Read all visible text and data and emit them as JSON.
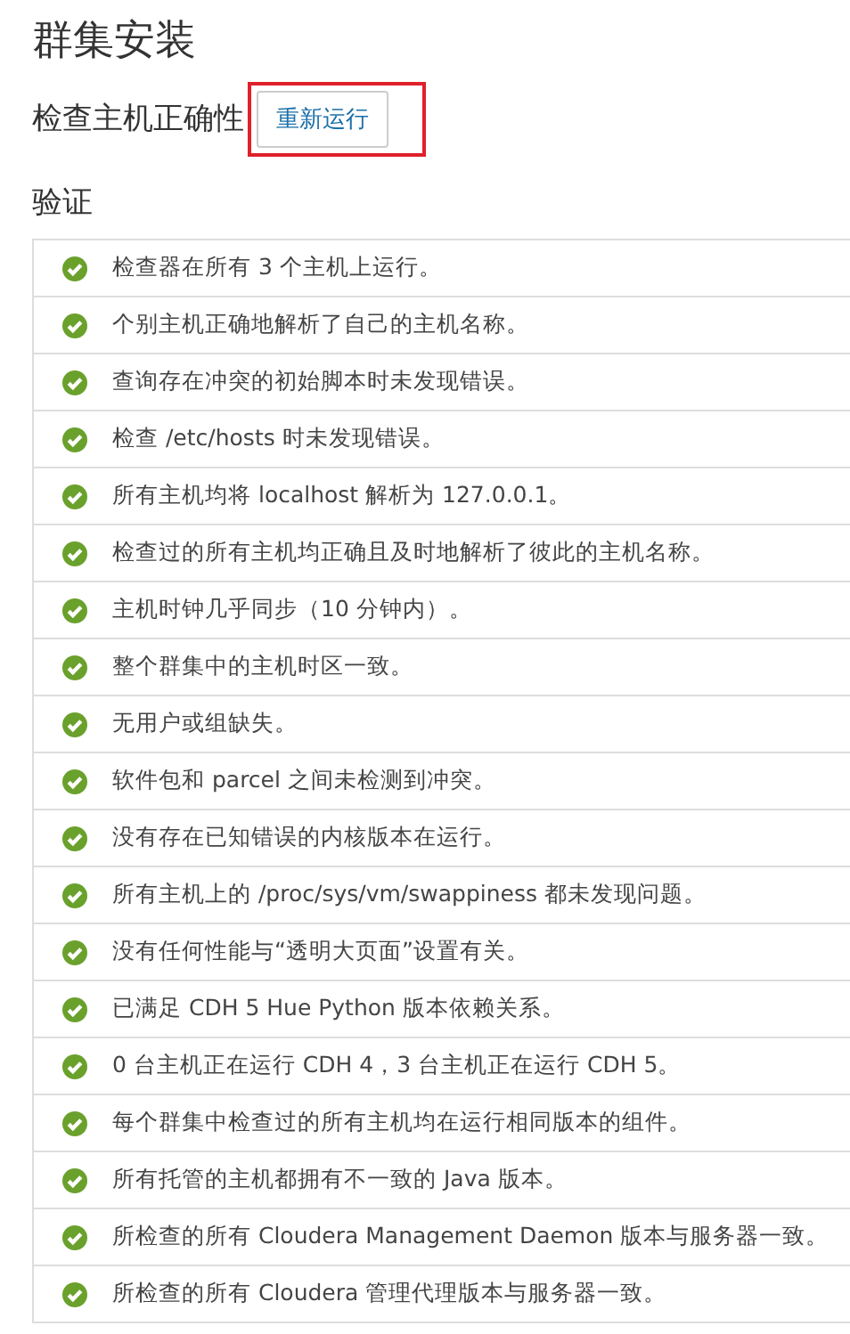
{
  "title": "群集安装",
  "section": {
    "heading": "检查主机正确性",
    "button": {
      "label": "重新运行",
      "highlighted": true
    }
  },
  "validation": {
    "heading": "验证",
    "checks": [
      {
        "passed": true,
        "text": "检查器在所有 3 个主机上运行。"
      },
      {
        "passed": true,
        "text": "个别主机正确地解析了自己的主机名称。"
      },
      {
        "passed": true,
        "text": "查询存在冲突的初始脚本时未发现错误。"
      },
      {
        "passed": true,
        "text": "检查 /etc/hosts 时未发现错误。"
      },
      {
        "passed": true,
        "text": "所有主机均将 localhost 解析为 127.0.0.1。"
      },
      {
        "passed": true,
        "text": "检查过的所有主机均正确且及时地解析了彼此的主机名称。"
      },
      {
        "passed": true,
        "text": "主机时钟几乎同步（10 分钟内）。"
      },
      {
        "passed": true,
        "text": "整个群集中的主机时区一致。"
      },
      {
        "passed": true,
        "text": "无用户或组缺失。"
      },
      {
        "passed": true,
        "text": "软件包和 parcel 之间未检测到冲突。"
      },
      {
        "passed": true,
        "text": "没有存在已知错误的内核版本在运行。"
      },
      {
        "passed": true,
        "text": "所有主机上的 /proc/sys/vm/swappiness 都未发现问题。"
      },
      {
        "passed": true,
        "text": "没有任何性能与“透明大页面”设置有关。"
      },
      {
        "passed": true,
        "text": "已满足 CDH 5 Hue Python 版本依赖关系。"
      },
      {
        "passed": true,
        "text": "0 台主机正在运行 CDH 4，3 台主机正在运行 CDH 5。"
      },
      {
        "passed": true,
        "text": "每个群集中检查过的所有主机均在运行相同版本的组件。"
      },
      {
        "passed": true,
        "text": "所有托管的主机都拥有不一致的 Java 版本。"
      },
      {
        "passed": true,
        "text": "所检查的所有 Cloudera Management Daemon 版本与服务器一致。"
      },
      {
        "passed": true,
        "text": "所检查的所有 Cloudera 管理代理版本与服务器一致。"
      }
    ]
  }
}
